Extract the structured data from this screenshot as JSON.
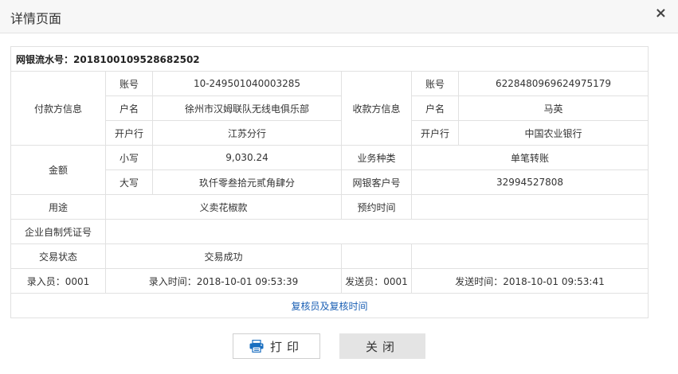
{
  "dialog": {
    "title": "详情页面",
    "close_glyph": "×"
  },
  "serial": {
    "label": "网银流水号：",
    "value": "2018100109528682502"
  },
  "payer": {
    "section_label": "付款方信息",
    "account_label": "账号",
    "account": "10-249501040003285",
    "name_label": "户名",
    "name": "徐州市汉姆联队无线电俱乐部",
    "bank_label": "开户行",
    "bank": "江苏分行"
  },
  "payee": {
    "section_label": "收款方信息",
    "account_label": "账号",
    "account": "6228480969624975179",
    "name_label": "户名",
    "name": "马英",
    "bank_label": "开户行",
    "bank": "中国农业银行"
  },
  "amount": {
    "label": "金额",
    "lower_label": "小写",
    "lower": "9,030.24",
    "upper_label": "大写",
    "upper": "玖仟零叁拾元贰角肆分"
  },
  "business_type": {
    "label": "业务种类",
    "value": "单笔转账"
  },
  "customer_no": {
    "label": "网银客户号",
    "value": "32994527808"
  },
  "purpose": {
    "label": "用途",
    "value": "义卖花椒款"
  },
  "scheduled_time": {
    "label": "预约时间",
    "value": ""
  },
  "voucher": {
    "label": "企业自制凭证号",
    "value": ""
  },
  "status": {
    "label": "交易状态",
    "value": "交易成功"
  },
  "entry": {
    "operator": "录入员：0001",
    "time": "录入时间：2018-10-01 09:53:39"
  },
  "send": {
    "operator": "发送员：0001",
    "time": "发送时间：2018-10-01 09:53:41"
  },
  "review": {
    "label": "复核员及复核时间"
  },
  "buttons": {
    "print": "打印",
    "close": "关闭"
  }
}
